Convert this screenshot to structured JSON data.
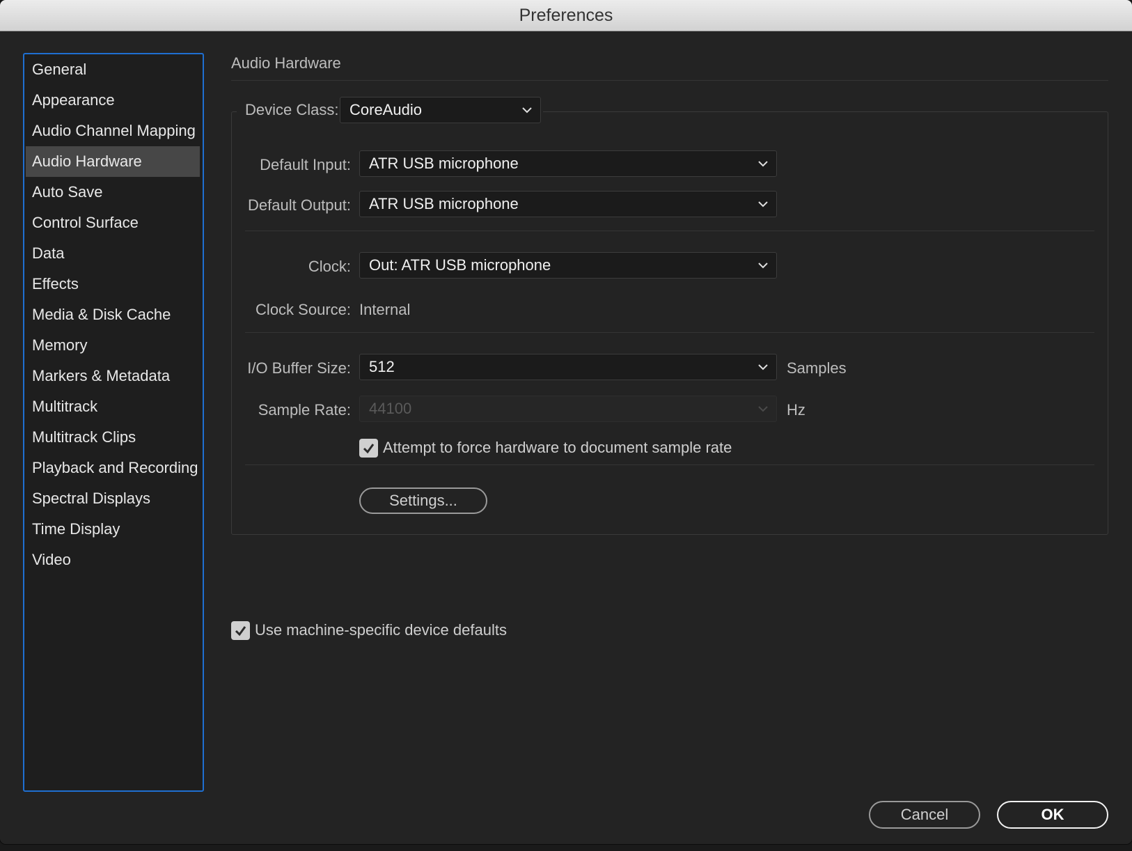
{
  "window": {
    "title": "Preferences"
  },
  "sidebar": {
    "selected": "Audio Hardware",
    "items": [
      {
        "label": "General"
      },
      {
        "label": "Appearance"
      },
      {
        "label": "Audio Channel Mapping"
      },
      {
        "label": "Audio Hardware"
      },
      {
        "label": "Auto Save"
      },
      {
        "label": "Control Surface"
      },
      {
        "label": "Data"
      },
      {
        "label": "Effects"
      },
      {
        "label": "Media & Disk Cache"
      },
      {
        "label": "Memory"
      },
      {
        "label": "Markers & Metadata"
      },
      {
        "label": "Multitrack"
      },
      {
        "label": "Multitrack Clips"
      },
      {
        "label": "Playback and Recording"
      },
      {
        "label": "Spectral Displays"
      },
      {
        "label": "Time Display"
      },
      {
        "label": "Video"
      }
    ]
  },
  "main": {
    "section_title": "Audio Hardware",
    "device_class": {
      "label": "Device Class:",
      "value": "CoreAudio"
    },
    "default_input": {
      "label": "Default Input:",
      "value": "ATR USB microphone"
    },
    "default_output": {
      "label": "Default Output:",
      "value": "ATR USB microphone"
    },
    "clock": {
      "label": "Clock:",
      "value": "Out: ATR USB microphone"
    },
    "clock_source": {
      "label": "Clock Source:",
      "value": "Internal"
    },
    "io_buffer": {
      "label": "I/O Buffer Size:",
      "value": "512",
      "unit": "Samples"
    },
    "sample_rate": {
      "label": "Sample Rate:",
      "value": "44100",
      "unit": "Hz",
      "disabled": true
    },
    "force_rate": {
      "label": "Attempt to force hardware to document sample rate",
      "checked": true
    },
    "settings_button": "Settings...",
    "machine_defaults": {
      "label": "Use machine-specific device defaults",
      "checked": true
    }
  },
  "footer": {
    "cancel": "Cancel",
    "ok": "OK"
  },
  "colors": {
    "accent": "#1f6fd1",
    "selected_bg": "#474747",
    "window_bg": "#232323"
  }
}
